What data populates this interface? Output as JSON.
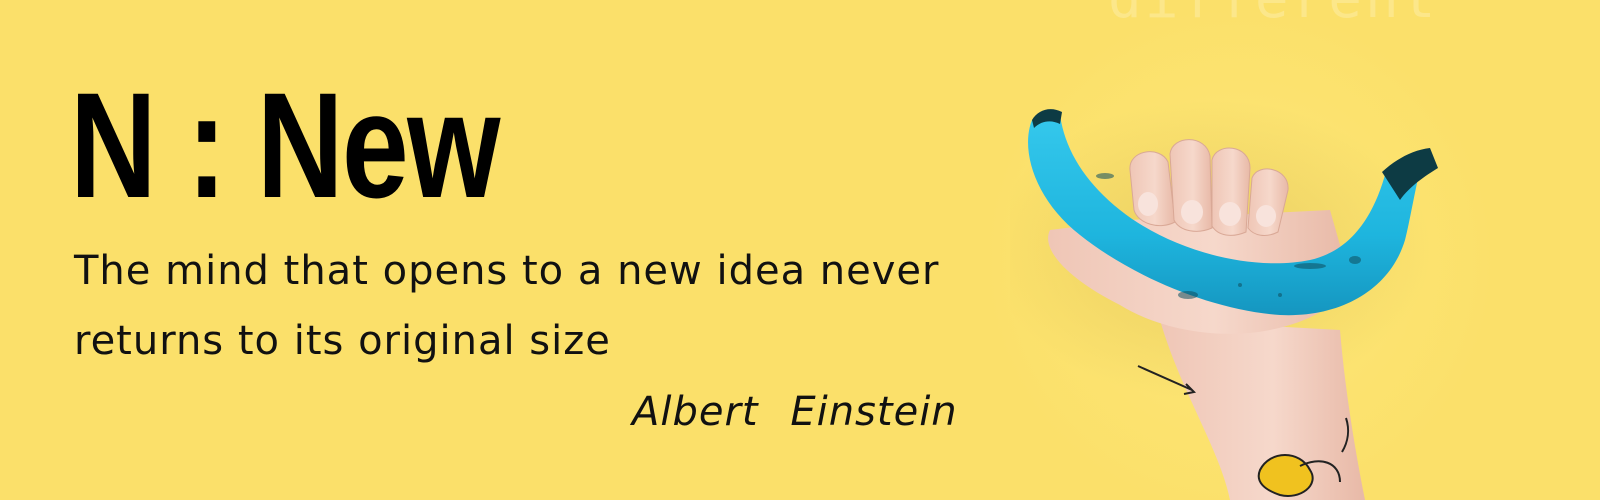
{
  "banner": {
    "ghost_word": "different",
    "title": "N : New",
    "quote": "The mind that opens to a new idea never returns to its original size",
    "author": "Albert  Einstein",
    "image_icon": "hand-holding-blue-banana",
    "colors": {
      "background": "#fbe06a",
      "text": "#000000",
      "banana": "#1fb8df",
      "banana_tip": "#0d3b44",
      "skin": "#f3cfc0"
    }
  }
}
